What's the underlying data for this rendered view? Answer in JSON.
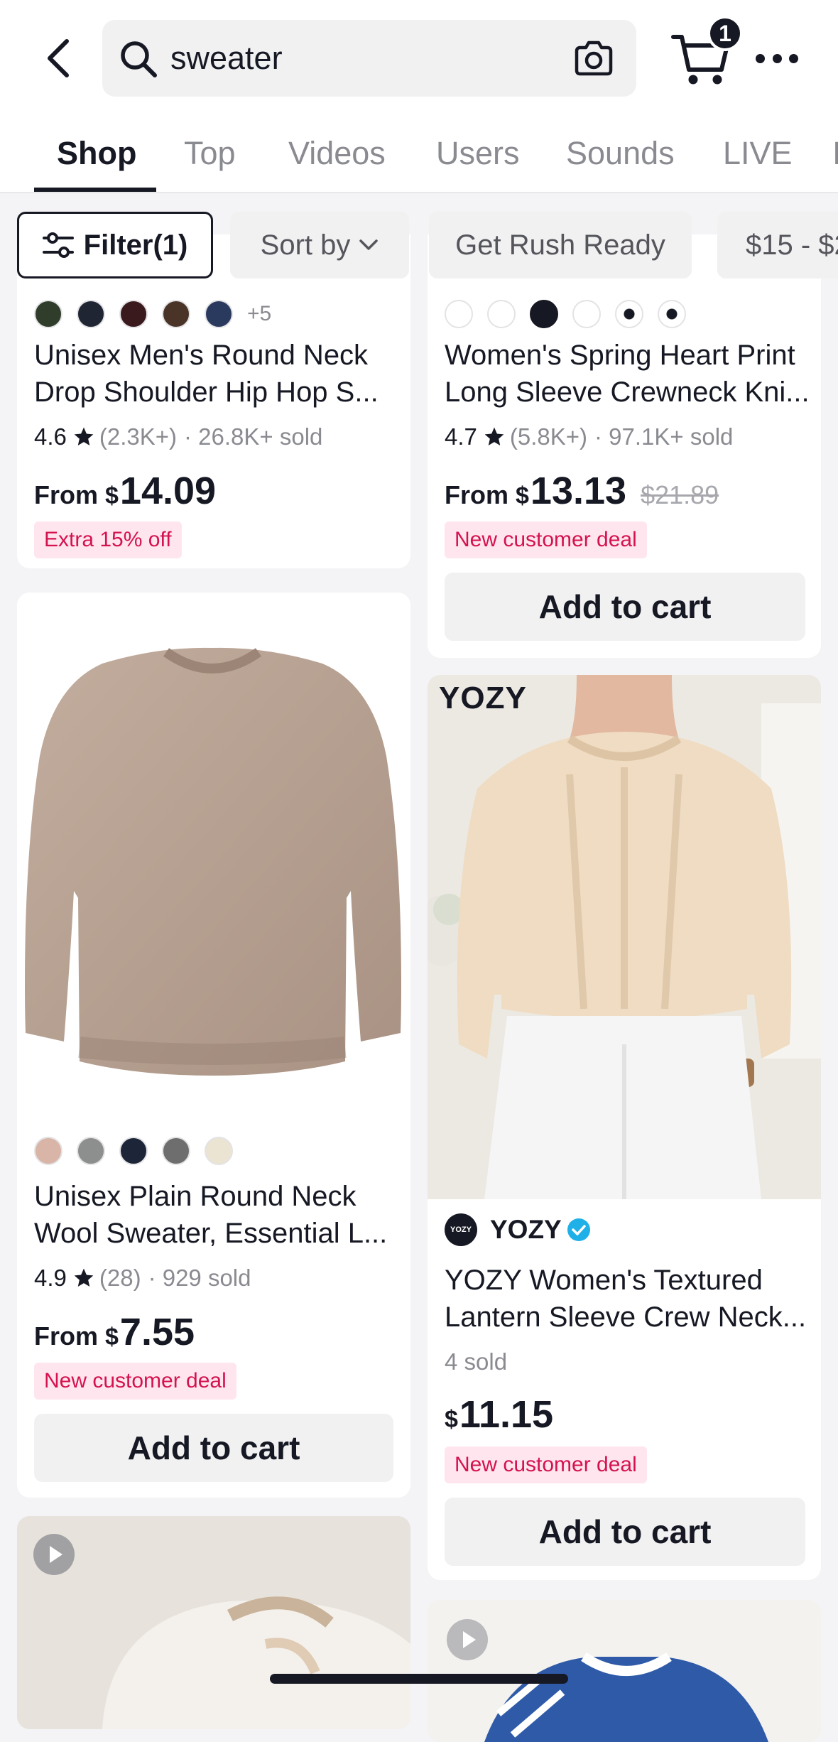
{
  "search": {
    "query": "sweater"
  },
  "cart": {
    "count": "1"
  },
  "tabs": [
    "Shop",
    "Top",
    "Videos",
    "Users",
    "Sounds",
    "LIVE",
    "I"
  ],
  "filters": {
    "filter_label": "Filter(1)",
    "sort_label": "Sort by",
    "rush_label": "Get Rush Ready",
    "price_label": "$15 - $2"
  },
  "products": [
    {
      "swatch_colors": [
        "#2f3d2a",
        "#1f2533",
        "#3b1a1e",
        "#4a3327",
        "#2a3a5e"
      ],
      "swatch_more": "+5",
      "title_line1": "Unisex Men's Round Neck",
      "title_line2": "Drop Shoulder Hip Hop S...",
      "rating": "4.6",
      "reviews": "(2.3K+)",
      "sold": "· 26.8K+ sold",
      "from": "From",
      "currency": "$",
      "price": "14.09",
      "badge": "Extra 15% off"
    },
    {
      "swatch_colors": [
        "#ffffff",
        "#ffffff",
        "#161823",
        "#ffffff",
        "#ffffff",
        "#ffffff"
      ],
      "title_line1": "Women's Spring Heart Print",
      "title_line2": "Long Sleeve Crewneck Kni...",
      "rating": "4.7",
      "reviews": "(5.8K+)",
      "sold": "· 97.1K+ sold",
      "from": "From",
      "currency": "$",
      "price": "13.13",
      "original_price": "$21.89",
      "badge": "New customer deal",
      "button": "Add to cart"
    },
    {
      "swatch_colors": [
        "#d8b5a6",
        "#8d8e8e",
        "#1d2638",
        "#6e6e6e",
        "#ece4d2"
      ],
      "title_line1": "Unisex Plain Round Neck",
      "title_line2": "Wool Sweater, Essential L...",
      "rating": "4.9",
      "reviews": "(28)",
      "sold": "· 929 sold",
      "from": "From",
      "currency": "$",
      "price": "7.55",
      "badge": "New customer deal",
      "button": "Add to cart"
    },
    {
      "brand_watermark": "YOZY",
      "shop_name": "YOZY",
      "shop_logo_text": "YOZY",
      "title_line1": "YOZY Women's Textured",
      "title_line2": "Lantern Sleeve Crew Neck...",
      "sold": "4 sold",
      "currency": "$",
      "price": "11.15",
      "badge": "New customer deal",
      "button": "Add to cart"
    }
  ],
  "colors": {
    "accent_pink": "#d4124f",
    "badge_bg": "#ffe6ee",
    "verified_blue": "#20b0e8"
  }
}
